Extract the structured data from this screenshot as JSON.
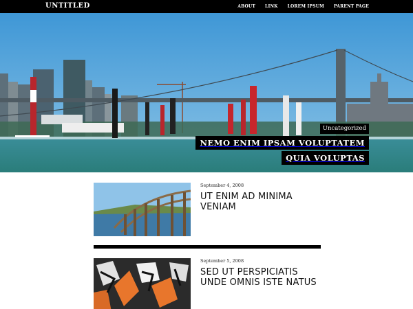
{
  "site": {
    "title": "UNTITLED"
  },
  "nav": {
    "items": [
      {
        "label": "ABOUT"
      },
      {
        "label": "LINK"
      },
      {
        "label": "LOREM IPSUM"
      },
      {
        "label": "PARENT PAGE"
      }
    ]
  },
  "hero": {
    "category": "Uncategorized",
    "title_line1": "NEMO ENIM IPSAM VOLUPTATEM",
    "title_line2": "QUIA VOLUPTAS"
  },
  "posts": [
    {
      "date": "September 4, 2008",
      "title": "UT ENIM AD MINIMA VENIAM",
      "thumb_icon": "boardwalk-pier-image"
    },
    {
      "date": "September 5, 2008",
      "title": "SED UT PERSPICIATIS UNDE OMNIS ISTE NATUS",
      "thumb_icon": "graffiti-wall-image"
    }
  ],
  "colors": {
    "bar": "#000000",
    "background": "#ffffff",
    "sky": "#4a9fd6",
    "water": "#2e8a8f"
  }
}
